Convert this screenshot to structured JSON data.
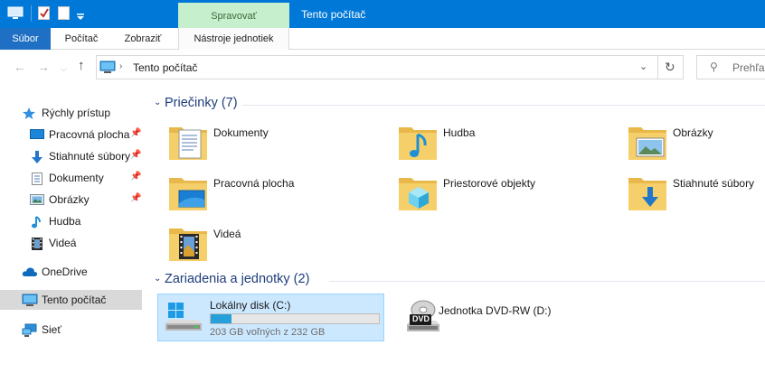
{
  "titlebar": {
    "title": "Tento počítač",
    "context_tab": "Spravovať"
  },
  "ribbon": {
    "tabs": [
      "Súbor",
      "Počítač",
      "Zobraziť",
      "Nástroje jednotiek"
    ]
  },
  "address": {
    "path": "Tento počítač",
    "search_placeholder": "Prehľadávať"
  },
  "sidebar": {
    "quick_access": "Rýchly prístup",
    "pinned": [
      "Pracovná plocha",
      "Stiahnuté súbory",
      "Dokumenty",
      "Obrázky"
    ],
    "recent": [
      "Hudba",
      "Videá"
    ],
    "onedrive": "OneDrive",
    "this_pc": "Tento počítač",
    "network": "Sieť"
  },
  "folders": {
    "title": "Priečinky (7)",
    "items": [
      "Dokumenty",
      "Hudba",
      "Obrázky",
      "Pracovná plocha",
      "Priestorové objekty",
      "Stiahnuté súbory",
      "Videá"
    ]
  },
  "devices": {
    "title": "Zariadenia a jednotky (2)",
    "drive_c": {
      "label": "Lokálny disk (C:)",
      "free": "203 GB voľných z 232 GB",
      "used_fraction": 0.125
    },
    "drive_d": {
      "label": "Jednotka DVD-RW (D:)",
      "badge": "DVD"
    }
  },
  "colors": {
    "accent": "#0078d7",
    "selection": "#cce8ff",
    "context_tab": "#c6efce",
    "drive_bar": "#26a0da"
  }
}
